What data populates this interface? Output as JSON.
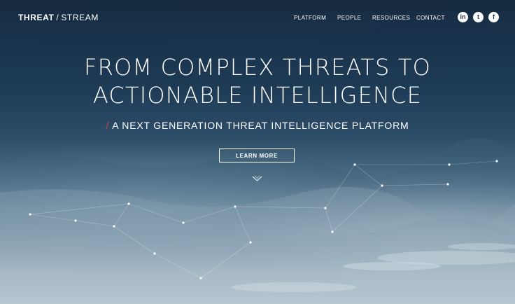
{
  "logo": {
    "bold": "THREAT",
    "separator": "/",
    "light": "STREAM"
  },
  "nav": {
    "items": [
      {
        "label": "PLATFORM"
      },
      {
        "label": "PEOPLE"
      },
      {
        "label": "RESOURCES"
      },
      {
        "label": "CONTACT"
      }
    ],
    "social": [
      {
        "icon": "linkedin-icon",
        "glyph": "in"
      },
      {
        "icon": "twitter-icon",
        "glyph": "t"
      },
      {
        "icon": "facebook-icon",
        "glyph": "f"
      }
    ]
  },
  "hero": {
    "headline_line1": "FROM COMPLEX THREATS TO",
    "headline_line2": "ACTIONABLE INTELLIGENCE",
    "sub_slash": "/",
    "subheadline": "A NEXT GENERATION THREAT INTELLIGENCE PLATFORM",
    "cta_label": "LEARN MORE",
    "scroll_icon": "chevron-down-icon"
  },
  "colors": {
    "accent": "#e0433f",
    "sky_top": "#162c43",
    "sky_bottom": "#b7c6cf",
    "text": "#ffffff"
  }
}
